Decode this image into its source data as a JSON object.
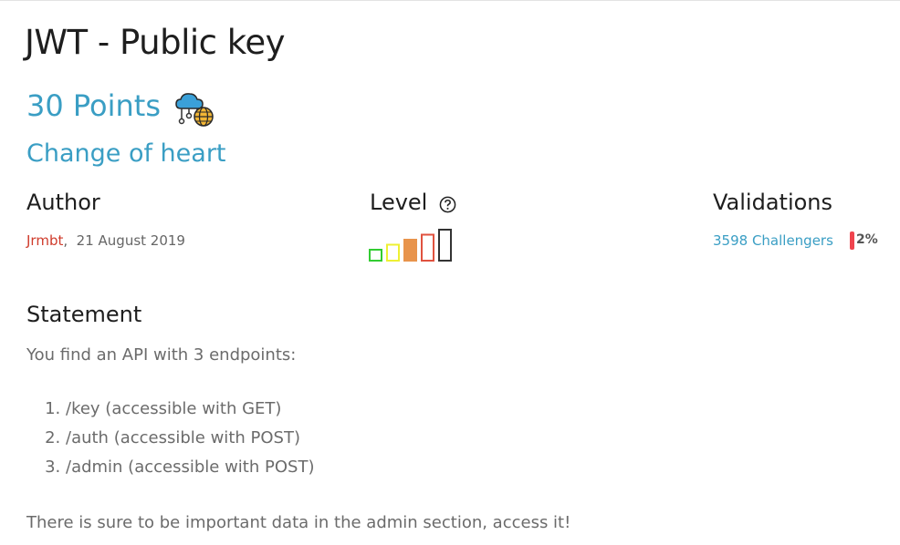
{
  "challenge": {
    "title": "JWT - Public key",
    "points": "30 Points",
    "category_icon": "cloud-network-globe-icon",
    "category": "Change of heart"
  },
  "author": {
    "heading": "Author",
    "name": "Jrmbt",
    "separator": ",",
    "date": "21 August 2019"
  },
  "level": {
    "heading": "Level",
    "help_icon": "question-circle-icon",
    "current": 3,
    "max": 5,
    "colors": [
      "#33cc33",
      "#eef033",
      "#e8944c",
      "#e0523f",
      "#333333"
    ]
  },
  "validations": {
    "heading": "Validations",
    "challengers": "3598 Challengers",
    "percent": "2%",
    "percent_color": "#f0444e"
  },
  "statement": {
    "heading": "Statement",
    "intro": "You find an API with 3 endpoints:",
    "endpoints": [
      "/key (accessible with GET)",
      "/auth (accessible with POST)",
      "/admin (accessible with POST)"
    ],
    "outro": "There is sure to be important data in the admin section, access it!"
  }
}
